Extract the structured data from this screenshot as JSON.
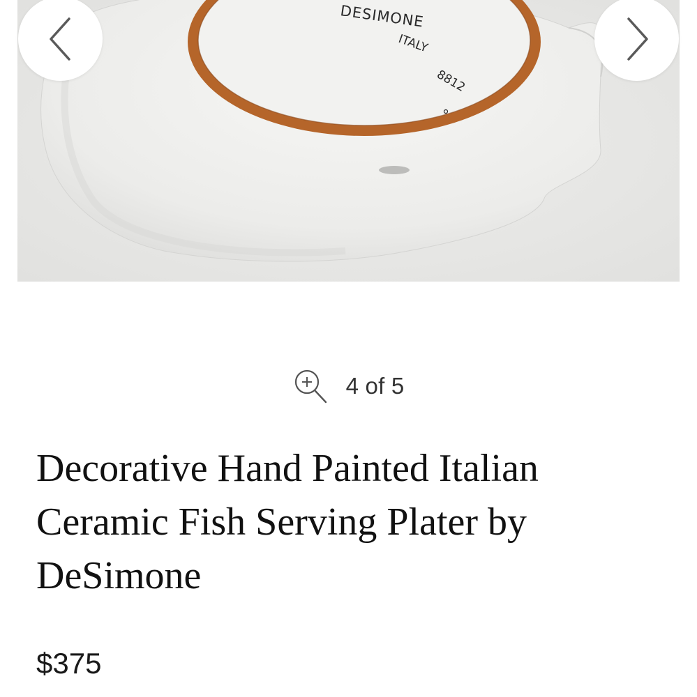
{
  "gallery": {
    "image": {
      "subject": "underside of ceramic fish serving platter",
      "handwritten_marking_lines": [
        "DESIMONE",
        "ITALY",
        "8812"
      ]
    },
    "prev_icon": "chevron-left-icon",
    "next_icon": "chevron-right-icon",
    "zoom_icon": "zoom-in-icon",
    "counter": "4 of 5"
  },
  "product": {
    "title": "Decorative Hand Painted Italian Ceramic Fish Serving Plater by DeSimone",
    "price": "$375"
  },
  "colors": {
    "glaze": "#f1f1ef",
    "terracotta_ring": "#b5652a",
    "background_surface": "#e9e9e7",
    "text_primary": "#111111",
    "button_bg": "#ffffff",
    "chevron": "#5a5a5a"
  }
}
